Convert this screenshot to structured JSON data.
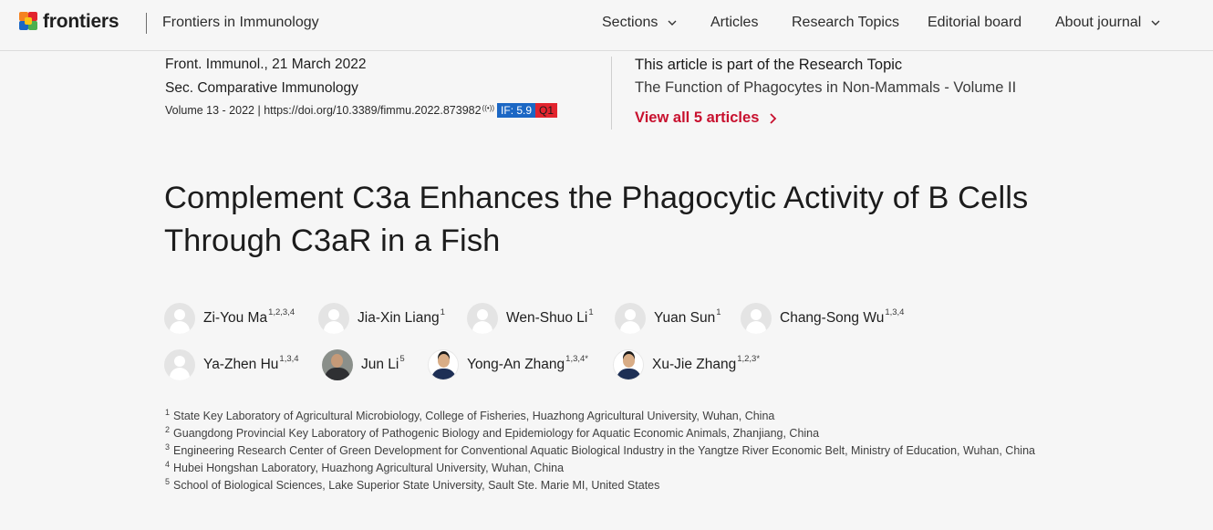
{
  "header": {
    "logo_text": "frontiers",
    "journal_name": "Frontiers in Immunology",
    "nav": [
      {
        "label": "Sections",
        "has_dropdown": true
      },
      {
        "label": "Articles",
        "has_dropdown": false
      },
      {
        "label": "Research Topics",
        "has_dropdown": false
      },
      {
        "label": "Editorial board",
        "has_dropdown": false
      },
      {
        "label": "About journal",
        "has_dropdown": true
      }
    ]
  },
  "article_meta": {
    "journal_date": "Front. Immunol., 21 March 2022",
    "section": "Sec. Comparative Immunology",
    "volume": "Volume 13 - 2022 | ",
    "doi": "https://doi.org/10.3389/fimmu.2022.873982",
    "oa_icon": "((•))",
    "impact_factor": "IF: 5.9",
    "quartile": "Q1"
  },
  "research_topic": {
    "kicker": "This article is part of the Research Topic",
    "title": "The Function of Phagocytes in Non-Mammals - Volume II",
    "view_all": "View all 5 articles"
  },
  "title_lines": [
    "Complement C3a Enhances the Phagocytic Activity of B Cells",
    "Through C3aR in a Fish"
  ],
  "authors": [
    {
      "name": "Zi-You Ma",
      "sup": "1,2,3,4",
      "avatar": "placeholder"
    },
    {
      "name": "Jia-Xin Liang",
      "sup": "1",
      "avatar": "placeholder"
    },
    {
      "name": "Wen-Shuo Li",
      "sup": "1",
      "avatar": "placeholder"
    },
    {
      "name": "Yuan Sun",
      "sup": "1",
      "avatar": "placeholder"
    },
    {
      "name": "Chang-Song Wu",
      "sup": "1,3,4",
      "avatar": "placeholder"
    },
    {
      "name": "Ya-Zhen Hu",
      "sup": "1,3,4",
      "avatar": "placeholder"
    },
    {
      "name": "Jun Li",
      "sup": "5",
      "avatar": "photo"
    },
    {
      "name": "Yong-An Zhang",
      "sup": "1,3,4*",
      "avatar": "photo"
    },
    {
      "name": "Xu-Jie Zhang",
      "sup": "1,2,3*",
      "avatar": "photo"
    }
  ],
  "affiliations": [
    {
      "num": "1",
      "text": "State Key Laboratory of Agricultural Microbiology, College of Fisheries, Huazhong Agricultural University, Wuhan, China"
    },
    {
      "num": "2",
      "text": "Guangdong Provincial Key Laboratory of Pathogenic Biology and Epidemiology for Aquatic Economic Animals, Zhanjiang, China"
    },
    {
      "num": "3",
      "text": "Engineering Research Center of Green Development for Conventional Aquatic Biological Industry in the Yangtze River Economic Belt, Ministry of Education, Wuhan, China"
    },
    {
      "num": "4",
      "text": "Hubei Hongshan Laboratory, Huazhong Agricultural University, Wuhan, China"
    },
    {
      "num": "5",
      "text": "School of Biological Sciences, Lake Superior State University, Sault Ste. Marie MI, United States"
    }
  ],
  "colors": {
    "accent_red": "#c8102e",
    "if_badge": "#1b67c4",
    "q1_badge": "#e2242e",
    "logo_orange": "#f58220",
    "logo_red": "#e2242e",
    "logo_blue": "#1b67c4",
    "logo_green": "#4caf50",
    "logo_yellow": "#f9c416"
  },
  "icons": {
    "nav_dropdown": "chevron-down-icon",
    "view_all_arrow": "chevron-right-icon",
    "author_placeholder": "user-avatar-icon"
  }
}
